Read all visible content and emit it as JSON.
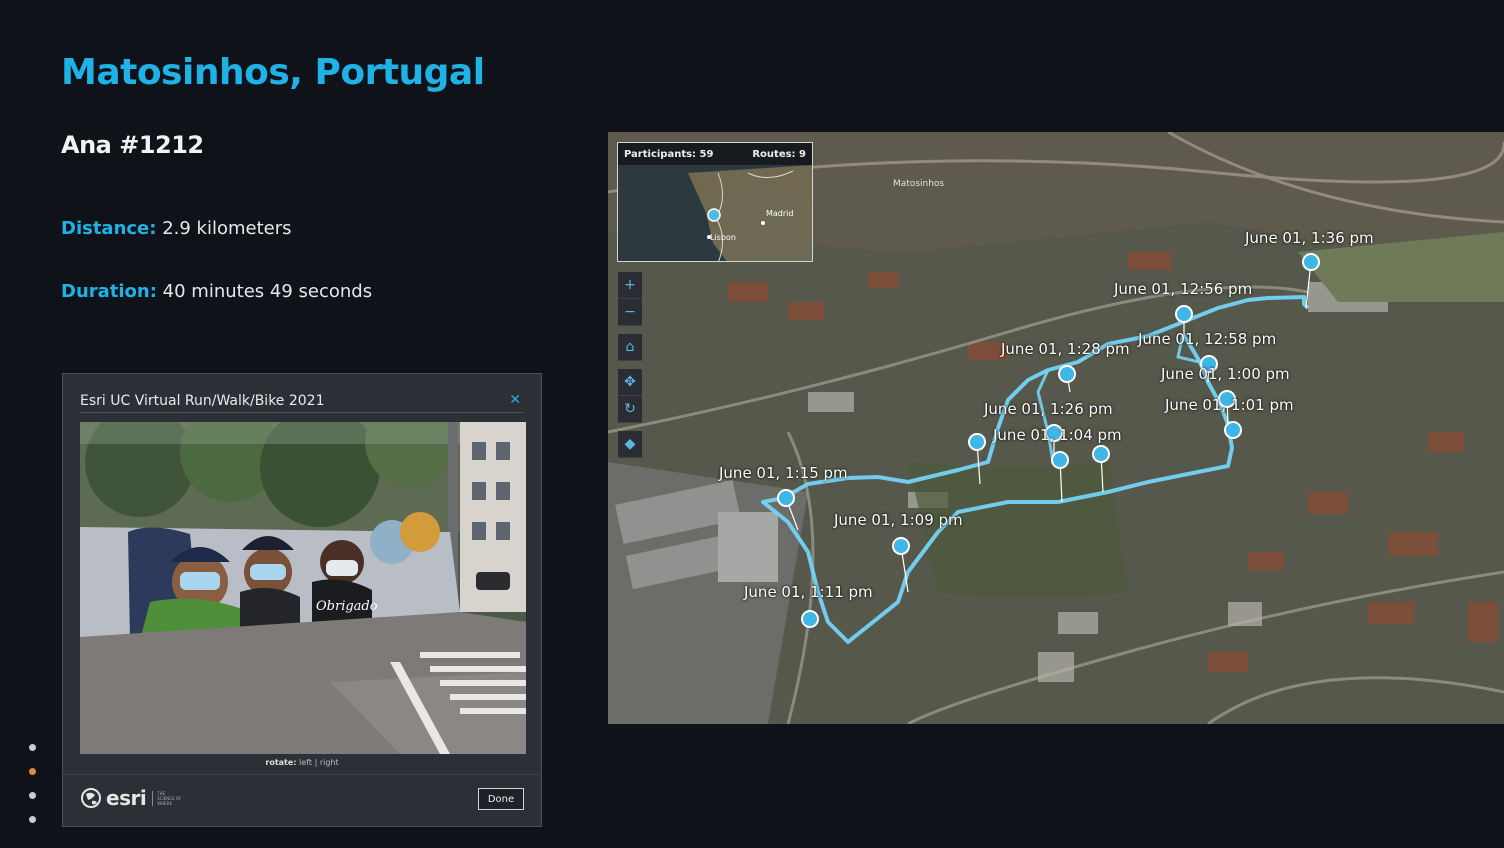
{
  "slide": {
    "title": "Matosinhos, Portugal",
    "runner": "Ana #1212",
    "distance_label": "Distance:",
    "distance_value": " 2.9 kilometers",
    "duration_label": "Duration:",
    "duration_value": " 40 minutes 49 seconds"
  },
  "popup": {
    "title": "Esri UC Virtual Run/Walk/Bike 2021",
    "close_icon": "close-icon",
    "rotate_label": "rotate:",
    "rotate_left": "left",
    "rotate_sep": "|",
    "rotate_right": "right",
    "logo_text": "esri",
    "logo_tagline": "THE SCIENCE OF WHERE",
    "done_label": "Done",
    "photo_text": "Obrigado"
  },
  "dots": {
    "count": 4,
    "active_index": 1
  },
  "map": {
    "overview": {
      "participants": "Participants: 59",
      "routes": "Routes: 9",
      "city_madrid": "Madrid",
      "city_lisbon": "Lisbon"
    },
    "tools": [
      "plus-icon",
      "minus-icon",
      "home-icon",
      "pan-icon",
      "rotate-icon",
      "compass-icon"
    ],
    "markers": [
      {
        "label": "June 01, 1:36 pm"
      },
      {
        "label": "June 01, 12:56 pm"
      },
      {
        "label": "June 01, 12:58 pm"
      },
      {
        "label": "June 01, 1:00 pm"
      },
      {
        "label": "June 01, 1:01 pm"
      },
      {
        "label": "June 01, 1:28 pm"
      },
      {
        "label": "June 01, 1:26 pm"
      },
      {
        "label": "June 01, 1:04 pm"
      },
      {
        "label": "June 01, 1:15 pm"
      },
      {
        "label": "June 01, 1:09 pm"
      },
      {
        "label": "June 01, 1:11 pm"
      }
    ],
    "place_label": "Matosinhos"
  },
  "colors": {
    "accent": "#1fb2e6",
    "background": "#0f1319",
    "route": "#6fd0f2",
    "dot_active": "#e08a3a"
  }
}
